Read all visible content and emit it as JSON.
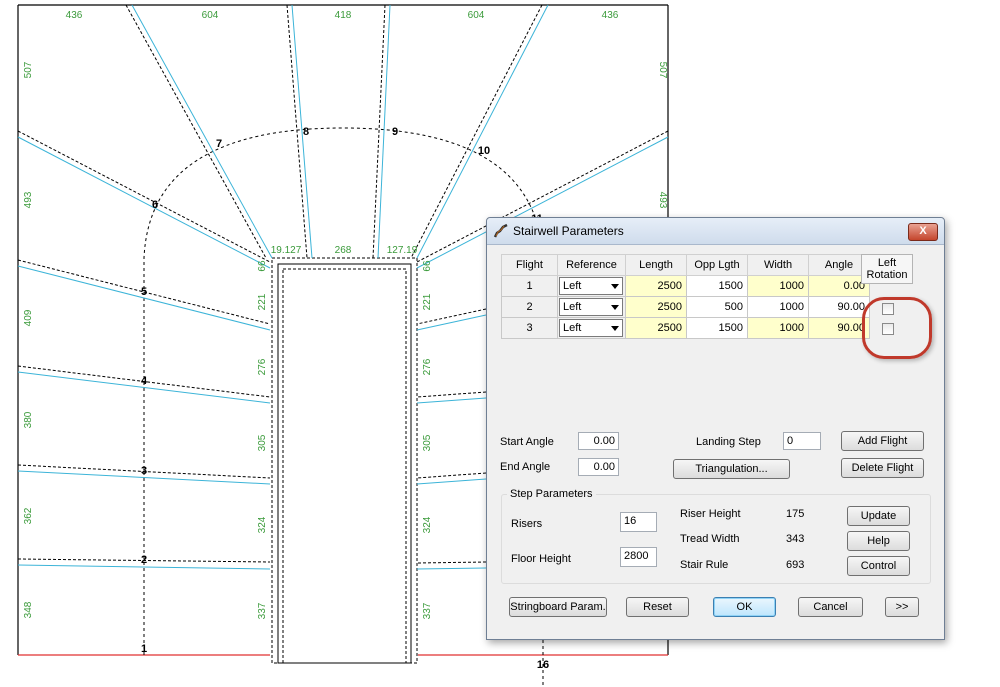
{
  "drawing": {
    "top_dims": [
      "436",
      "604",
      "418",
      "604",
      "436"
    ],
    "left_dims": [
      "507",
      "493",
      "409",
      "380",
      "362",
      "348"
    ],
    "right_dims": [
      "507",
      "493"
    ],
    "inner_left_dims": [
      "66",
      "221",
      "276",
      "305",
      "324",
      "337"
    ],
    "inner_right_dims": [
      "66",
      "221",
      "276",
      "305",
      "324",
      "337"
    ],
    "landing_dims": [
      "19.127",
      "268",
      "127.19"
    ],
    "step_numbers": [
      "1",
      "2",
      "3",
      "4",
      "5",
      "6",
      "7",
      "8",
      "9",
      "10",
      "11",
      "16"
    ],
    "colors": {
      "tread_line": "#3cb4d8",
      "dimension_text": "#3a9a3a",
      "edge_red": "#e03030"
    }
  },
  "dialog": {
    "title": "Stairwell Parameters",
    "close_label": "X",
    "columns": [
      "Flight",
      "Reference",
      "Length",
      "Opp Lgth",
      "Width",
      "Angle"
    ],
    "left_rotation_header_line1": "Left",
    "left_rotation_header_line2": "Rotation",
    "flights": [
      {
        "flight": "1",
        "reference": "Left",
        "length": "2500",
        "opp_length": "1500",
        "width": "1000",
        "angle": "0.00",
        "left_rotation": null
      },
      {
        "flight": "2",
        "reference": "Left",
        "length": "2500",
        "opp_length": "500",
        "width": "1000",
        "angle": "90.00",
        "left_rotation": false
      },
      {
        "flight": "3",
        "reference": "Left",
        "length": "2500",
        "opp_length": "1500",
        "width": "1000",
        "angle": "90.00",
        "left_rotation": false
      }
    ],
    "start_angle_label": "Start Angle",
    "start_angle_value": "0.00",
    "end_angle_label": "End Angle",
    "end_angle_value": "0.00",
    "landing_step_label": "Landing Step",
    "landing_step_value": "0",
    "add_flight_label": "Add Flight",
    "delete_flight_label": "Delete Flight",
    "triangulation_label": "Triangulation...",
    "step_group_title": "Step Parameters",
    "risers_label": "Risers",
    "risers_value": "16",
    "floor_height_label": "Floor Height",
    "floor_height_value": "2800",
    "riser_height_label": "Riser Height",
    "riser_height_value": "175",
    "tread_width_label": "Tread Width",
    "tread_width_value": "343",
    "stair_rule_label": "Stair Rule",
    "stair_rule_value": "693",
    "update_label": "Update",
    "help_label": "Help",
    "control_label": "Control",
    "stringboard_label": "Stringboard Param.",
    "reset_label": "Reset",
    "ok_label": "OK",
    "cancel_label": "Cancel",
    "more_label": ">>"
  }
}
